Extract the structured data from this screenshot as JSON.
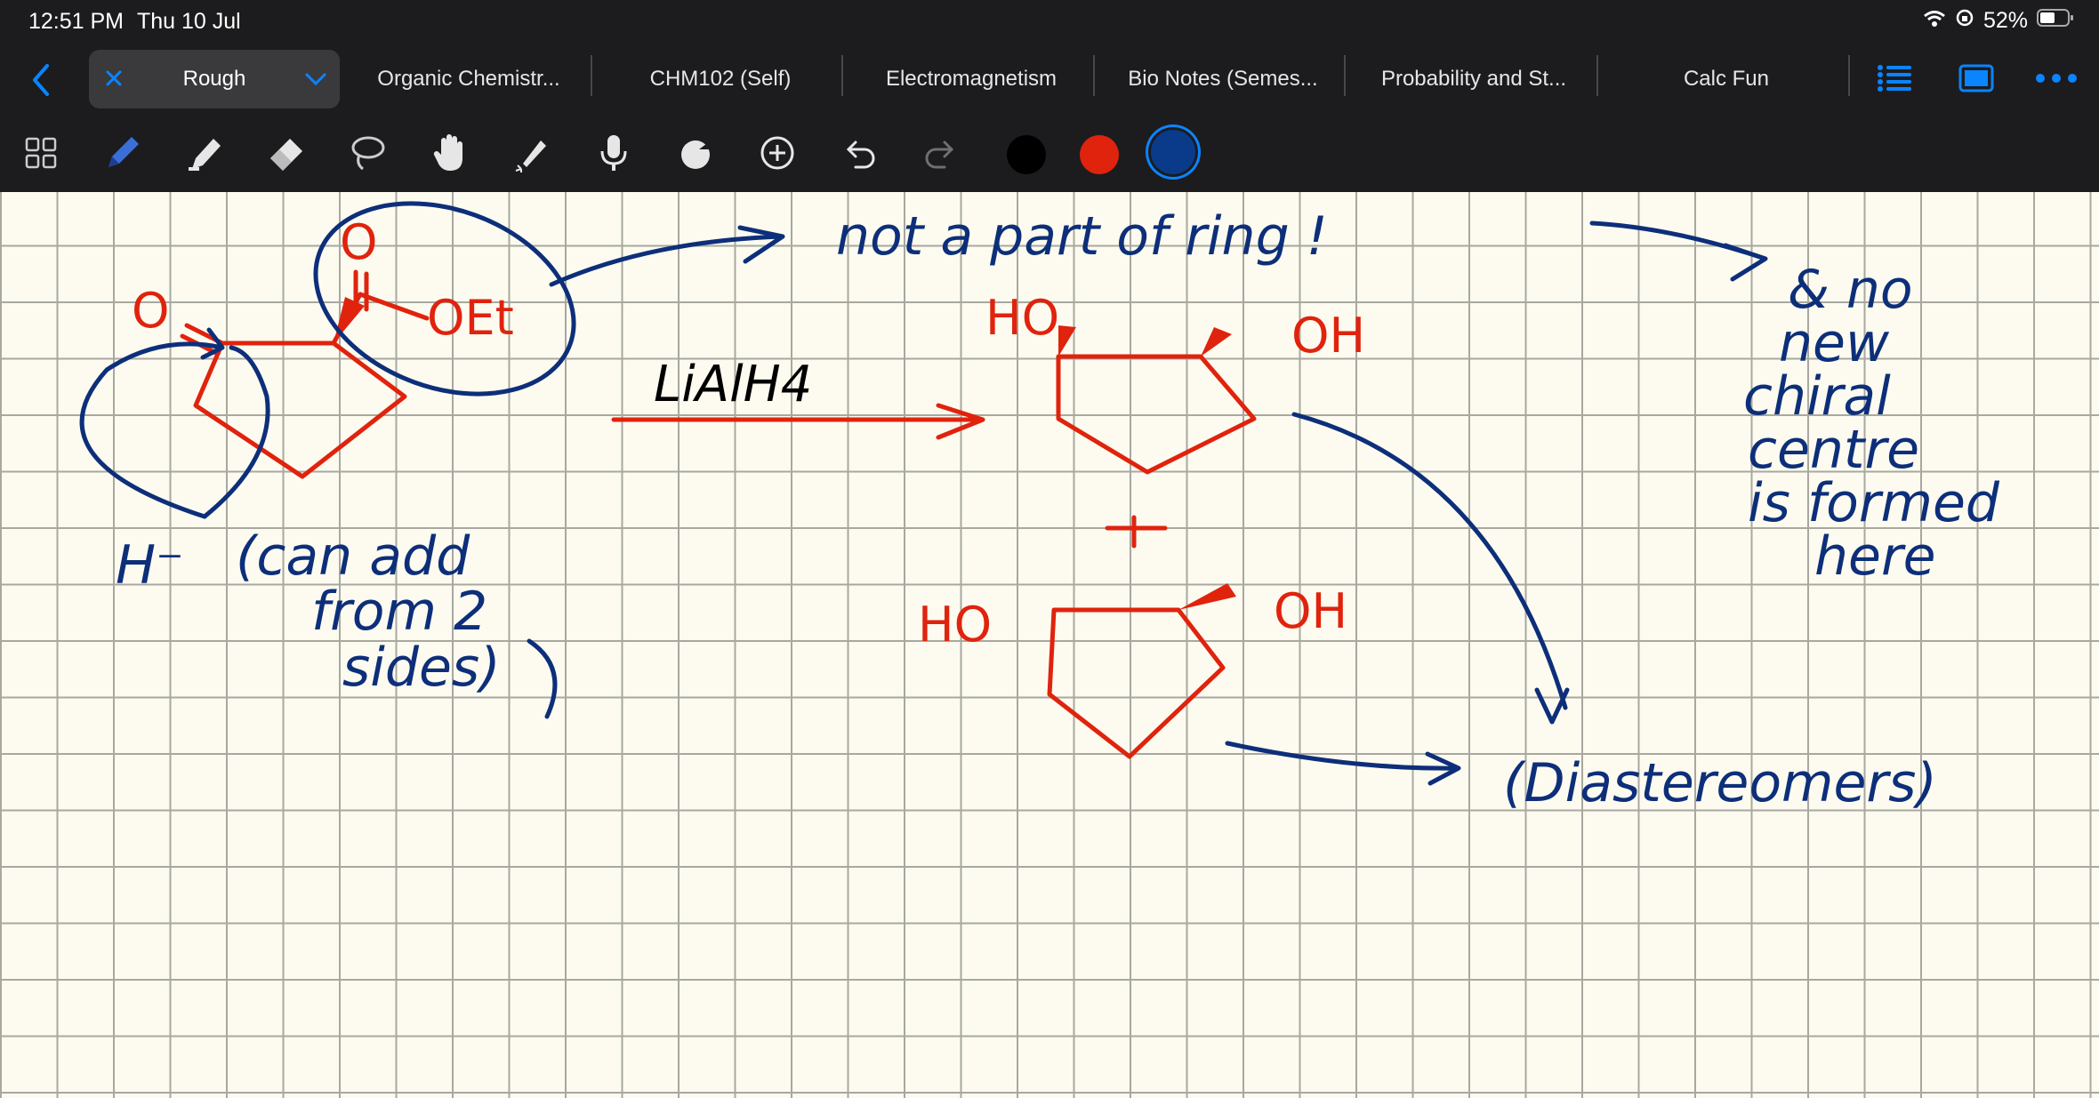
{
  "status": {
    "time": "12:51 PM",
    "date": "Thu 10 Jul",
    "battery": "52%"
  },
  "tabs": [
    {
      "label": "Rough",
      "active": true
    },
    {
      "label": "Organic Chemistr..."
    },
    {
      "label": "CHM102 (Self)"
    },
    {
      "label": "Electromagnetism"
    },
    {
      "label": "Bio Notes (Semes..."
    },
    {
      "label": "Probability and St..."
    },
    {
      "label": "Calc Fun"
    }
  ],
  "toolbar": {
    "tools": [
      "grid-icon",
      "pen-icon",
      "highlighter-icon",
      "eraser-icon",
      "lasso-icon",
      "hand-icon",
      "laser-pointer-icon",
      "microphone-icon",
      "shapes-icon",
      "add-icon",
      "undo-icon",
      "redo-icon"
    ],
    "colors": [
      "#000000",
      "#e0230d",
      "#0a3a8a"
    ]
  },
  "notes": {
    "reagent": "LiAlH4",
    "ring_note": "not a part of ring !",
    "chiral_note": [
      "& no",
      "new",
      "chiral",
      "centre",
      "is formed",
      "here"
    ],
    "hydride": "H⁻",
    "add_note": [
      "(can add",
      "from 2",
      "sides)"
    ],
    "diastereomers": "(Diastereomers)",
    "label_o1": "O",
    "label_o2": "O",
    "label_oet": "OEt",
    "label_ho1": "HO",
    "label_oh1": "OH",
    "label_ho2": "HO",
    "label_oh2": "OH",
    "plus": "+"
  },
  "accent": {
    "blue": "#0a84ff",
    "ink_blue": "#0d2f7a",
    "ink_red": "#e0230d"
  }
}
